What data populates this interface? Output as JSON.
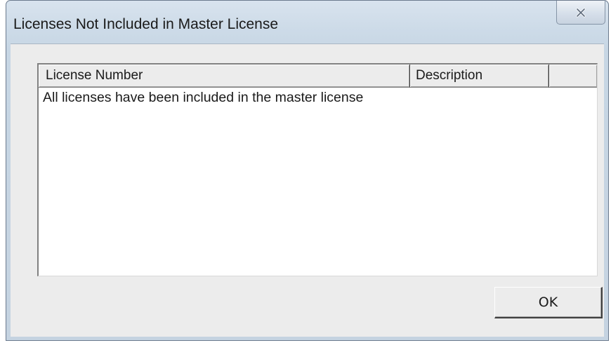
{
  "window": {
    "title": "Licenses Not Included in Master License",
    "close_icon": "close-icon"
  },
  "list": {
    "columns": [
      {
        "label": "License Number"
      },
      {
        "label": "Description"
      },
      {
        "label": ""
      }
    ],
    "items": [
      {
        "text": "All licenses have been included in the master license"
      }
    ]
  },
  "buttons": {
    "ok_label": "OK"
  }
}
